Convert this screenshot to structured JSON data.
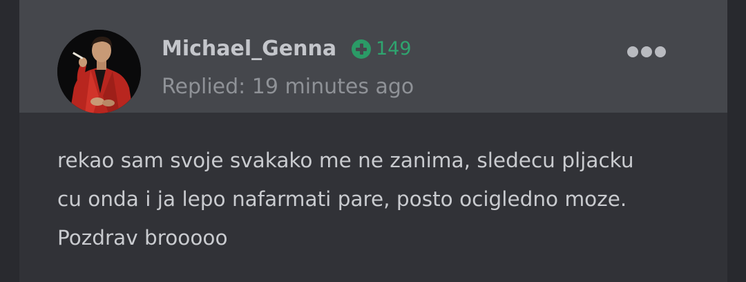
{
  "post": {
    "author": {
      "username": "Michael_Genna",
      "reputation": "149",
      "reputation_icon": "plus-circle-icon",
      "avatar": "user-avatar-photo"
    },
    "meta": {
      "replied_label": "Replied: 19 minutes ago"
    },
    "menu_icon": "ellipsis-icon",
    "body": [
      "rekao sam svoje svakako me ne zanima, sledecu pljacku",
      "cu onda i ja lepo nafarmati pare, posto ocigledno moze.",
      "Pozdrav brooooo"
    ]
  },
  "colors": {
    "page_background": "#292a2f",
    "card_background": "#313237",
    "header_background": "#45474c",
    "username": "#c4c6cb",
    "reputation": "#2fa46f",
    "meta_text": "#8f9297",
    "body_text": "#c9cbcf"
  }
}
